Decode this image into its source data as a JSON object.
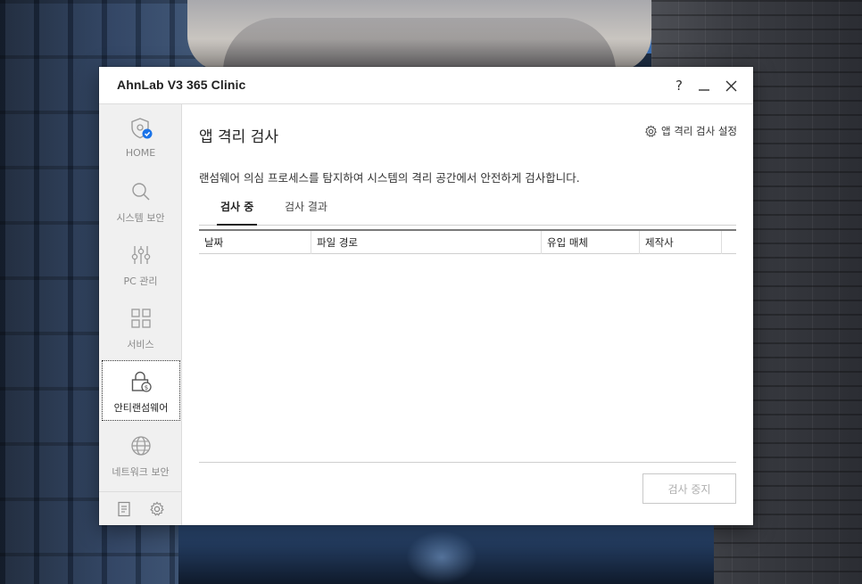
{
  "window": {
    "title": "AhnLab V3 365 Clinic",
    "help_label": "?"
  },
  "sidebar": {
    "items": [
      {
        "label": "HOME",
        "icon": "shield-check-icon"
      },
      {
        "label": "시스템 보안",
        "icon": "search-icon"
      },
      {
        "label": "PC 관리",
        "icon": "sliders-icon"
      },
      {
        "label": "서비스",
        "icon": "grid-icon"
      },
      {
        "label": "안티랜섬웨어",
        "icon": "lock-coin-icon",
        "selected": true
      },
      {
        "label": "네트워크 보안",
        "icon": "globe-icon"
      }
    ],
    "bottom_icons": [
      "document-icon",
      "gear-icon"
    ]
  },
  "main": {
    "title": "앱 격리 검사",
    "settings_label": "앱 격리 검사 설정",
    "description": "랜섬웨어 의심 프로세스를 탐지하여 시스템의 격리 공간에서 안전하게 검사합니다.",
    "tabs": [
      {
        "label": "검사 중",
        "active": true
      },
      {
        "label": "검사 결과",
        "active": false
      }
    ],
    "table": {
      "columns": [
        "날짜",
        "파일 경로",
        "유입 매체",
        "제작사",
        ""
      ],
      "rows": []
    },
    "stop_button_label": "검사 중지"
  },
  "colors": {
    "accent": "#1a73e8",
    "icon_gray": "#9a9a9a",
    "sidebar_bg": "#f0f0f0"
  }
}
